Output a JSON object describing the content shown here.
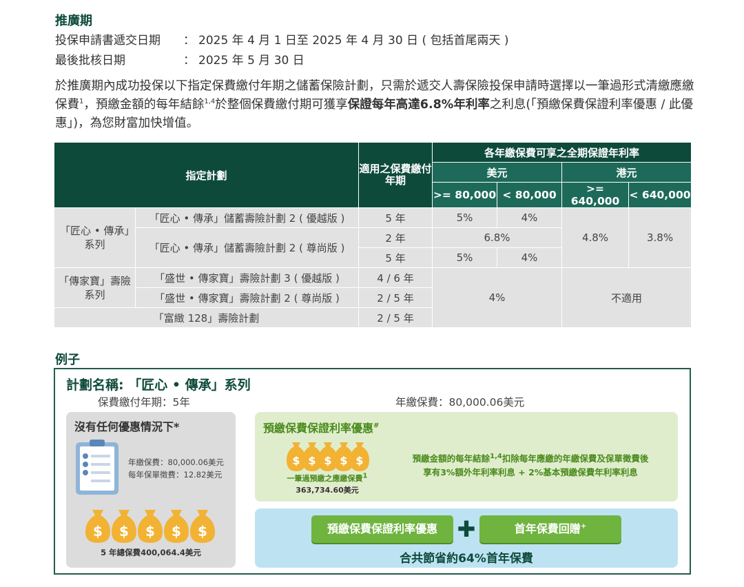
{
  "promo": {
    "title": "推廣期",
    "submission_label": "投保申請書遞交日期",
    "submission_value": "2025 年 4 月 1 日至 2025 年 4 月 30 日 ( 包括首尾兩天 )",
    "approval_label": "最後批核日期",
    "approval_value": "2025 年 5 月 30 日",
    "colon": "：",
    "para_part1": "於推廣期內成功投保以下指定保費繳付年期之儲蓄保險計劃，只需於遞交人壽保險投保申請時選擇以一筆過形式清繳應繳保費",
    "para_sup1": "1",
    "para_part2": "，預繳金額的每年結餘",
    "para_sup2": "1,4",
    "para_part3": "於整個保費繳付期可獲享",
    "para_bold": "保證每年高達6.8%年利率",
    "para_part4": "之利息(「預繳保費保證利率優惠 / 此優惠」)，為您財富加快增值。"
  },
  "table": {
    "h_plan": "指定計劃",
    "h_term": "適用之保費繳付年期",
    "h_rate": "各年繳保費可享之全期保證年利率",
    "h_usd": "美元",
    "h_hkd": "港元",
    "h_usd_hi": ">= 80,000",
    "h_usd_lo": "< 80,000",
    "h_hkd_hi": ">= 640,000",
    "h_hkd_lo": "< 640,000",
    "series1": "「匠心 • 傳承」系列",
    "series2": "「傳家寶」壽險系列",
    "plan1": "「匠心 • 傳承」儲蓄壽險計劃 2 ( 優越版 )",
    "plan2": "「匠心 • 傳承」儲蓄壽險計劃 2 ( 尊尚版 )",
    "plan3": "「盛世 • 傳家寶」壽險計劃 3 ( 優越版 )",
    "plan4": "「盛世 • 傳家寶」壽險計劃 2 ( 尊尚版 )",
    "plan5": "「富緻 128」壽險計劃",
    "t1": "5 年",
    "t2": "2 年",
    "t3": "5 年",
    "t4": "4 / 6 年",
    "t5": "2 / 5 年",
    "t6": "2 / 5 年",
    "r1a": "5%",
    "r1b": "4%",
    "r2": "6.8%",
    "r3a": "5%",
    "r3b": "4%",
    "hkd_hi": "4.8%",
    "hkd_lo": "3.8%",
    "group2_usd": "4%",
    "group2_hkd": "不適用"
  },
  "example": {
    "title": "例子",
    "plan_name": "計劃名稱: 「匠心 • 傳承」系列",
    "pay_term": "保費繳付年期：5年",
    "annual_premium": "年繳保費：80,000.06美元",
    "no_offer_title": "沒有任何優惠情況下*",
    "info1": "年繳保費：80,000.06美元",
    "info2": "每年保單徵費：12.82美元",
    "total": "5 年總保費400,064.4美元",
    "offer_title": "預繳保費保證利率優惠",
    "offer_title_sup": "#",
    "lump_caption": "一筆過預繳之應繳保費",
    "lump_caption_sup": "1",
    "lump_amount": "363,734.60美元",
    "offer_text1": "預繳金額的每年結餘",
    "offer_text1_sup": "1,4",
    "offer_text2": "扣除每年應繳的年繳保費及保單徵費後",
    "offer_text3": "享有3%額外年利率利息 + 2%基本預繳保費年利率利息",
    "btn1": "預繳保費保證利率優惠",
    "btn2": "首年保費回贈",
    "btn2_sup": "+",
    "plus": "✚",
    "saving": "合共節省約64%首年保費",
    "dollar": "$"
  },
  "colors": {
    "dark_green": "#0e4a3a",
    "mid_green": "#1d6a5a",
    "light_green": "#6fb43f",
    "gold": "#f2b233"
  }
}
